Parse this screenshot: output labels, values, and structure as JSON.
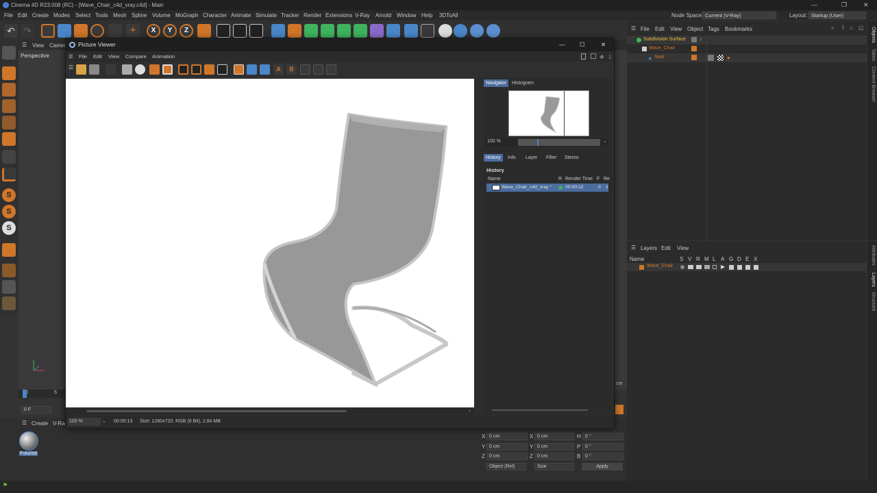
{
  "app": {
    "title": "Cinema 4D R23.008 (RC) - [Wave_Chair_c4d_vray.c4d] - Main",
    "window_controls": [
      "—",
      "❐",
      "✕"
    ]
  },
  "menubar": {
    "items": [
      "File",
      "Edit",
      "Create",
      "Modes",
      "Select",
      "Tools",
      "Mesh",
      "Spline",
      "Volume",
      "MoGraph",
      "Character",
      "Animate",
      "Simulate",
      "Tracker",
      "Render",
      "Extensions",
      "V-Ray",
      "Arnold",
      "Window",
      "Help",
      "3DToAll"
    ],
    "node_space_label": "Node Space:",
    "node_space_value": "Current (V-Ray)",
    "layout_label": "Layout:",
    "layout_value": "Startup (User)"
  },
  "viewport": {
    "menu": [
      "View",
      "Camer"
    ],
    "name": "Perspective",
    "timeline_ticks": [
      "0",
      "5"
    ],
    "frame_field": "0 F"
  },
  "picture_viewer": {
    "title": "Picture Viewer",
    "window_controls": [
      "—",
      "☐",
      "✕"
    ],
    "menu": [
      "File",
      "Edit",
      "View",
      "Compare",
      "Animation"
    ],
    "tabs_top": [
      "Navigator",
      "Histogram"
    ],
    "zoom": "100 %",
    "tabs_bottom": [
      "History",
      "Info",
      "Layer",
      "Filter",
      "Stereo"
    ],
    "history_heading": "History",
    "history_columns": [
      "Name",
      "R",
      "Render Time",
      "F",
      "Re"
    ],
    "history_row": {
      "name": "Wave_Chair_c4d_vray *",
      "time": "00:00:12",
      "f": "0",
      "re": "1"
    },
    "status_zoom": "100 %",
    "status_time": "00:00:13",
    "status_size": "Size: 1280x720, RGB (8 Bit), 2.84 MB"
  },
  "object_manager": {
    "menu": [
      "File",
      "Edit",
      "View",
      "Object",
      "Tags",
      "Bookmarks"
    ],
    "objects": [
      "Subdivision Surface",
      "Wave_Chair",
      "Seat"
    ]
  },
  "layers": {
    "menu": [
      "Layers",
      "Edit",
      "View"
    ],
    "col_name": "Name",
    "cols": [
      "S",
      "V",
      "R",
      "M",
      "L",
      "A",
      "G",
      "D",
      "E",
      "X"
    ],
    "layer_name": "Wave_Chair"
  },
  "vertical_tabs_top": [
    "Objects",
    "Takes",
    "Content Browser"
  ],
  "vertical_tabs_bottom": [
    "Attributes",
    "Layers",
    "Structure"
  ],
  "material_manager": {
    "menu": [
      "Create",
      "V-Ra"
    ],
    "material_name": "Futuristi"
  },
  "coordinates": {
    "rows": [
      {
        "a": "X",
        "av": "0 cm",
        "b": "X",
        "bv": "0 cm",
        "c": "H",
        "cv": "0 °"
      },
      {
        "a": "Y",
        "av": "0 cm",
        "b": "Y",
        "bv": "0 cm",
        "c": "P",
        "cv": "0 °"
      },
      {
        "a": "Z",
        "av": "0 cm",
        "b": "Z",
        "bv": "0 cm",
        "c": "B",
        "cv": "0 °"
      }
    ],
    "mode": "Object (Rel)",
    "size_mode": "Size",
    "apply": "Apply",
    "unit_fragment": "cm"
  },
  "colors": {
    "accent_blue": "#4b6c9e",
    "object_orange": "#d0762a",
    "object_green": "#3fb35f"
  }
}
